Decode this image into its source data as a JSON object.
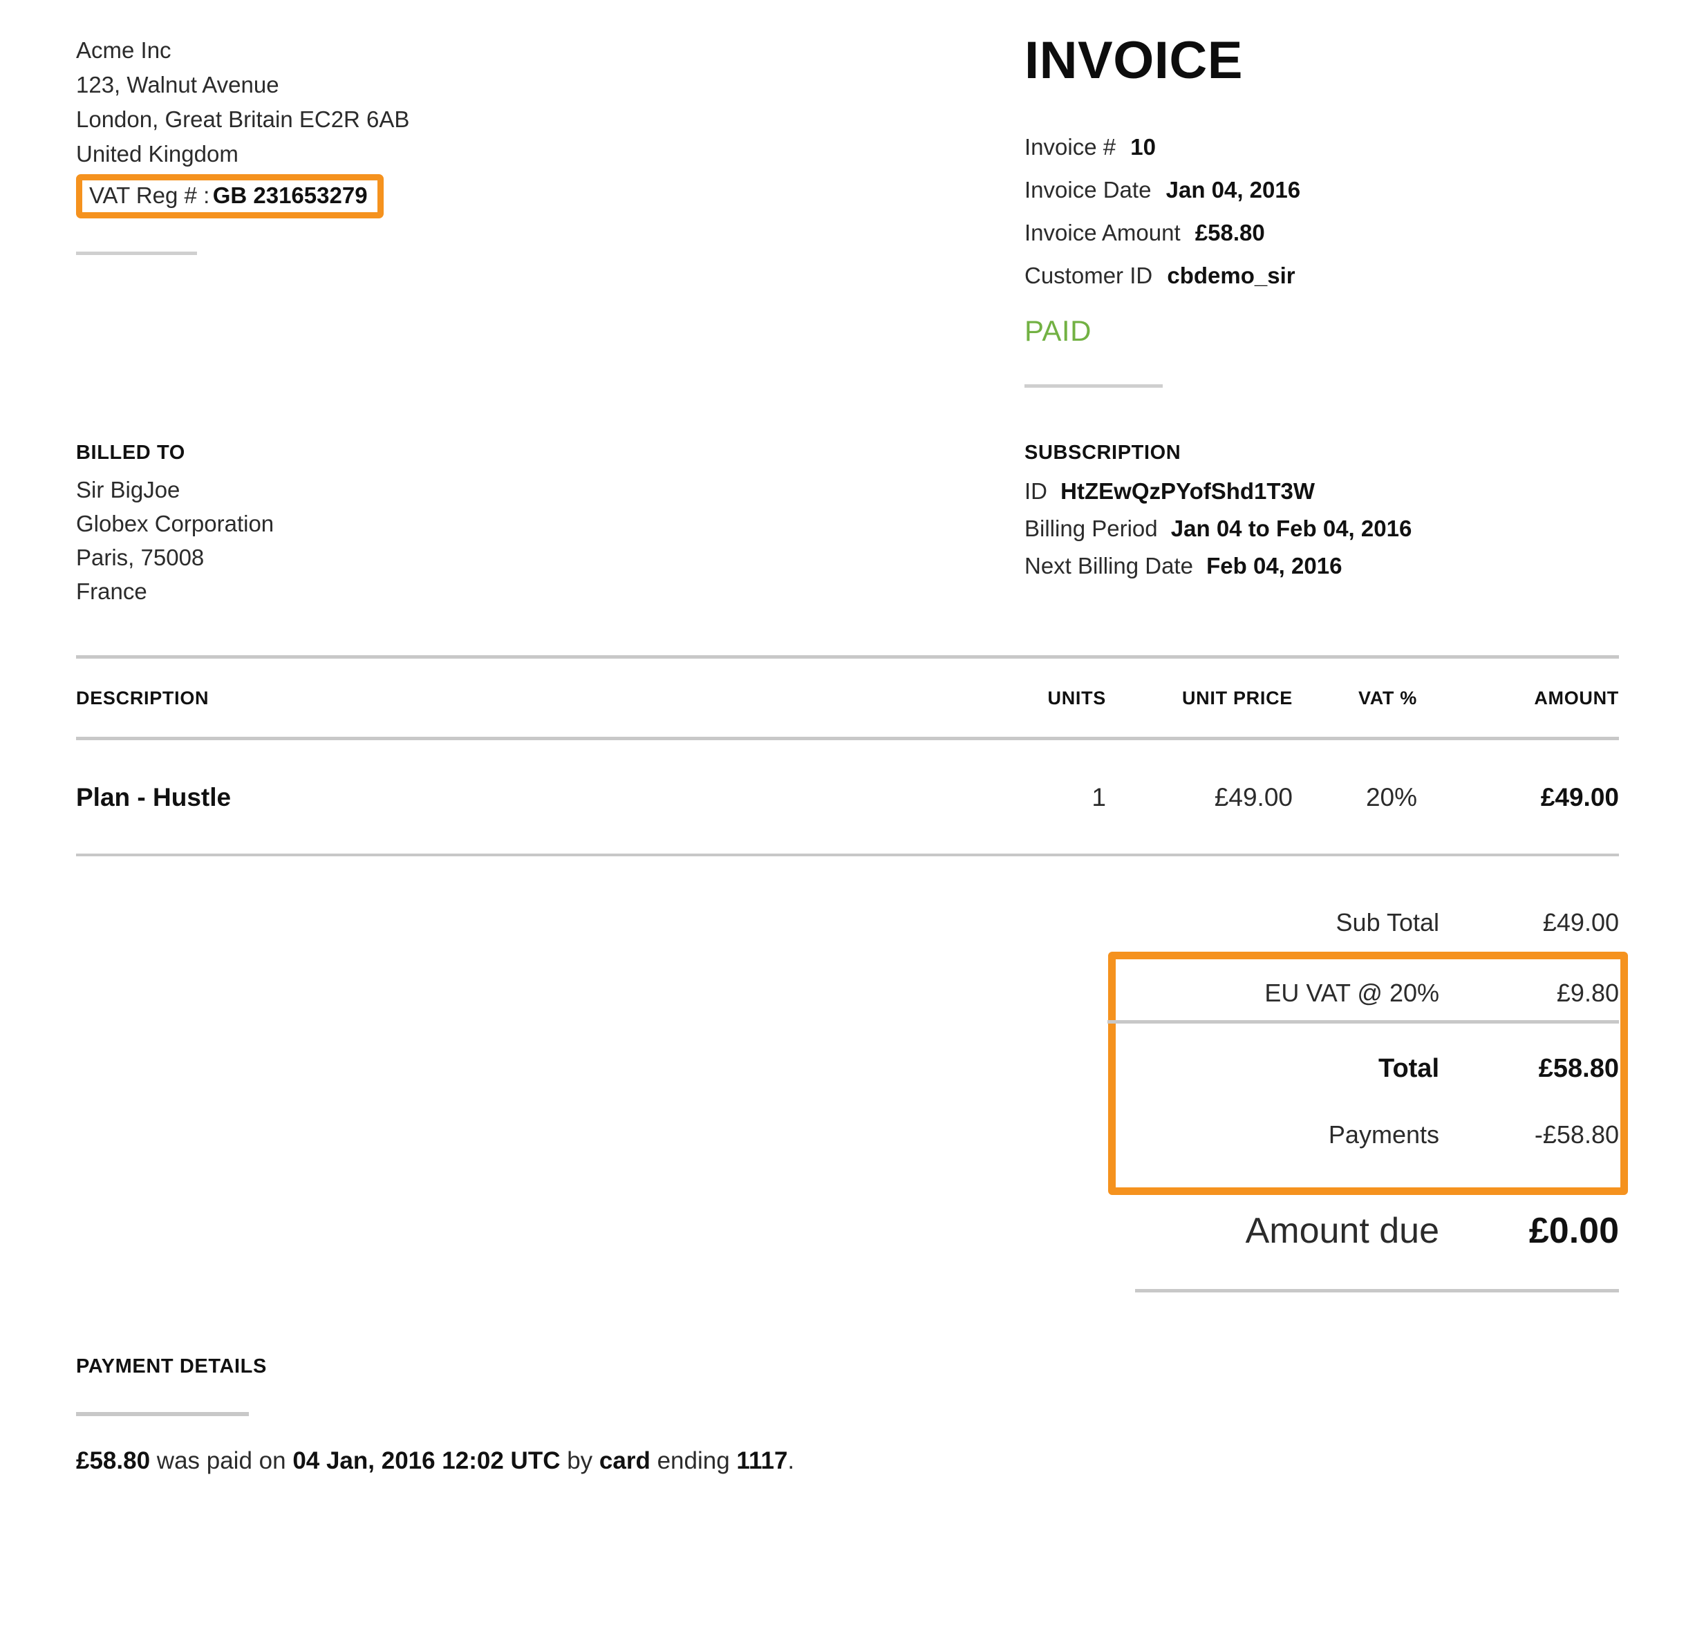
{
  "company": {
    "name": "Acme Inc",
    "address_line1": "123, Walnut Avenue",
    "address_line2": "London, Great Britain EC2R 6AB",
    "country": "United Kingdom",
    "vat_label": "VAT Reg # :",
    "vat_value": "GB 231653279"
  },
  "invoice": {
    "title": "INVOICE",
    "number_label": "Invoice #",
    "number_value": "10",
    "date_label": "Invoice Date",
    "date_value": "Jan 04, 2016",
    "amount_label": "Invoice Amount",
    "amount_value": "£58.80",
    "customer_label": "Customer ID",
    "customer_value": "cbdemo_sir",
    "status": "PAID",
    "status_color": "#72B143"
  },
  "billed_to": {
    "heading": "BILLED TO",
    "line1": "Sir BigJoe",
    "line2": "Globex Corporation",
    "line3": "Paris, 75008",
    "line4": "France"
  },
  "subscription": {
    "heading": "SUBSCRIPTION",
    "id_label": "ID",
    "id_value": "HtZEwQzPYofShd1T3W",
    "period_label": "Billing Period",
    "period_value": "Jan 04 to Feb 04, 2016",
    "next_label": "Next Billing Date",
    "next_value": "Feb 04, 2016"
  },
  "table": {
    "headers": {
      "description": "DESCRIPTION",
      "units": "UNITS",
      "unit_price": "UNIT PRICE",
      "vat_pct": "VAT %",
      "amount": "AMOUNT"
    },
    "rows": [
      {
        "description": "Plan - Hustle",
        "units": "1",
        "unit_price": "£49.00",
        "vat_pct": "20%",
        "amount": "£49.00"
      }
    ]
  },
  "totals": {
    "subtotal_label": "Sub Total",
    "subtotal_value": "£49.00",
    "vat_label": "EU VAT @ 20%",
    "vat_value": "£9.80",
    "total_label": "Total",
    "total_value": "£58.80",
    "payments_label": "Payments",
    "payments_value": "-£58.80",
    "due_label": "Amount due",
    "due_value": "£0.00"
  },
  "payment_details": {
    "heading": "PAYMENT DETAILS",
    "amount": "£58.80",
    "text_1": " was paid on ",
    "date": "04 Jan, 2016 12:02 UTC",
    "text_2": " by ",
    "method": "card",
    "text_3": " ending ",
    "card_last4": "1117",
    "text_4": "."
  },
  "highlight_color": "#F5921E"
}
